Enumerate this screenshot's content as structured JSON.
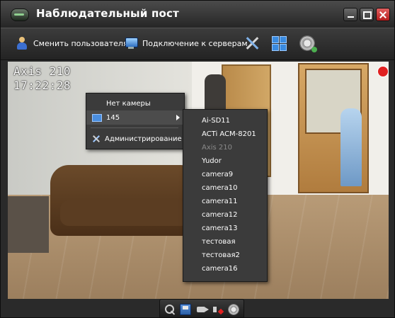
{
  "window": {
    "title": "Наблюдательный пост"
  },
  "toolbar": {
    "change_user_label": "Сменить пользователя",
    "connect_servers_label": "Подключение к серверам",
    "icons": [
      "user-icon",
      "server-icon",
      "tools-icon",
      "grid-layout-icon",
      "film-reel-icon"
    ]
  },
  "camera_view": {
    "camera_name": "Axis 210",
    "timestamp": "17:22:28",
    "recording_color": "#e02020"
  },
  "context_menu": {
    "no_camera_label": "Нет камеры",
    "server_group_label": "145",
    "administration_label": "Администрирование"
  },
  "submenu": {
    "items": [
      {
        "label": "Ai-SD11",
        "disabled": false
      },
      {
        "label": "ACTi ACM-8201",
        "disabled": false
      },
      {
        "label": "Axis 210",
        "disabled": true
      },
      {
        "label": "Yudor",
        "disabled": false
      },
      {
        "label": "camera9",
        "disabled": false
      },
      {
        "label": "camera10",
        "disabled": false
      },
      {
        "label": "camera11",
        "disabled": false
      },
      {
        "label": "camera12",
        "disabled": false
      },
      {
        "label": "camera13",
        "disabled": false
      },
      {
        "label": "тестовая",
        "disabled": false
      },
      {
        "label": "тестовая2",
        "disabled": false
      },
      {
        "label": "camera16",
        "disabled": false
      }
    ]
  },
  "bottom_controls": [
    "zoom-icon",
    "save-icon",
    "camera-icon",
    "mute-icon",
    "film-reel-icon"
  ]
}
